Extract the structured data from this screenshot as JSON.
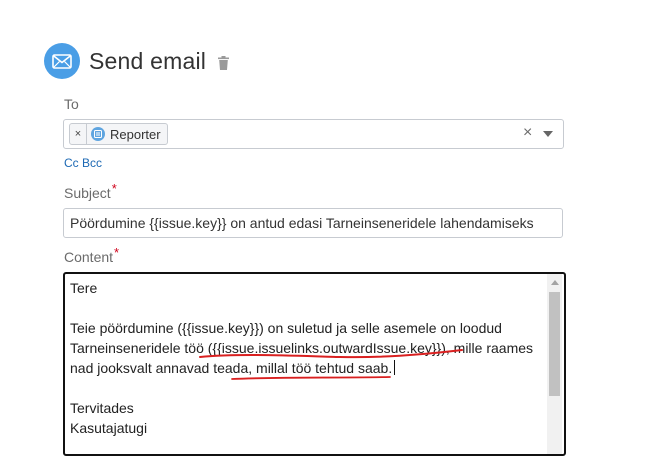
{
  "header": {
    "title": "Send email",
    "icon": "envelope-icon",
    "delete_icon": "trash-icon"
  },
  "to": {
    "label": "To",
    "chips": [
      {
        "label": "Reporter",
        "remove": "×"
      }
    ],
    "clear": "×"
  },
  "cc_bcc": "Cc Bcc",
  "subject": {
    "label": "Subject",
    "required_mark": "*",
    "value": "Pöördumine {{issue.key}} on antud edasi Tarneinseneridele lahendamiseks"
  },
  "content": {
    "label": "Content",
    "required_mark": "*",
    "lines": [
      "Tere",
      "",
      "Teie pöördumine ({{issue.key}}) on suletud ja selle asemele on loodud",
      "Tarneinseneridele töö ({{issue.issuelinks.outwardIssue.key}}), mille raames",
      "nad jooksvalt annavad teada, millal töö tehtud saab.",
      "",
      "Tervitades",
      "Kasutajatugi"
    ]
  },
  "colors": {
    "accent": "#4a9ee6",
    "link": "#1d69b4",
    "required": "#d0021b",
    "annotation": "#d92020"
  }
}
